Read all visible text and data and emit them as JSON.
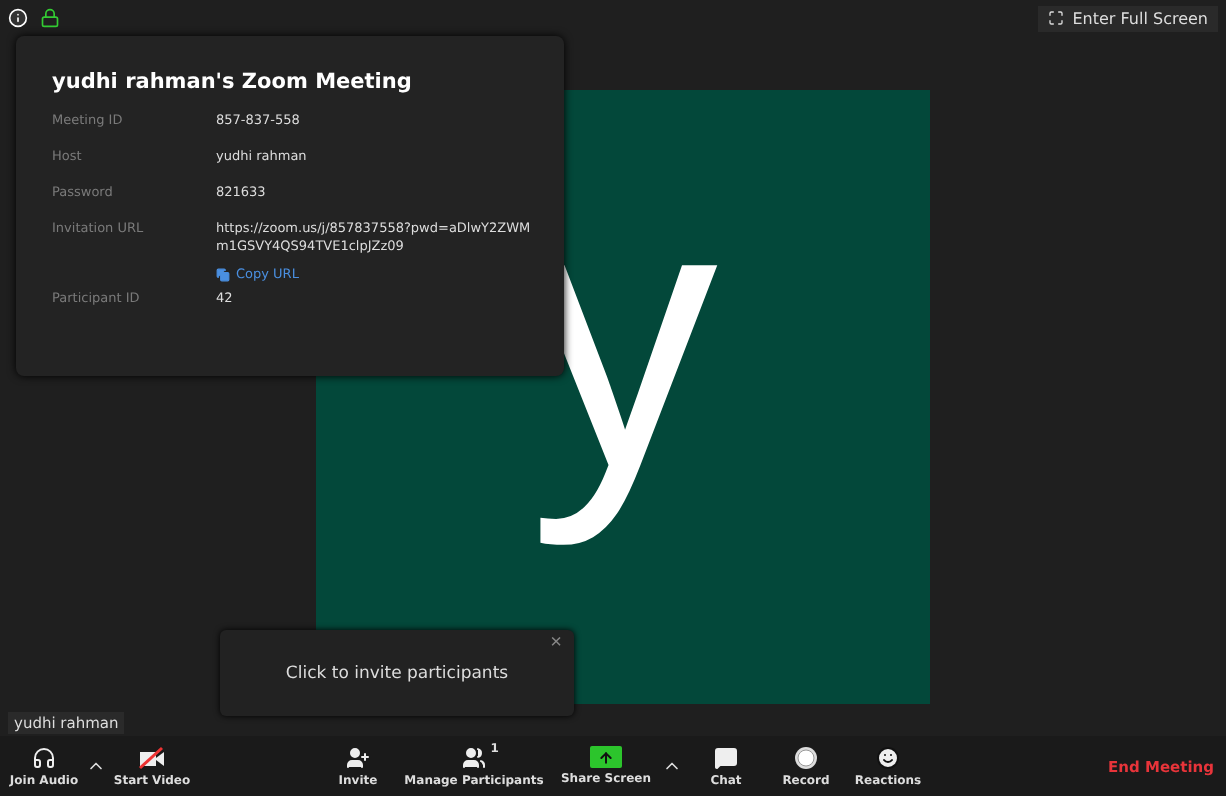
{
  "top_bar": {
    "fullscreen_button": "Enter Full Screen"
  },
  "meeting_info": {
    "title": "yudhi rahman's Zoom Meeting",
    "fields": [
      {
        "label": "Meeting ID",
        "value": "857-837-558"
      },
      {
        "label": "Host",
        "value": "yudhi rahman"
      },
      {
        "label": "Password",
        "value": "821633"
      },
      {
        "label": "Invitation URL",
        "value": "https://zoom.us/j/857837558?pwd=aDlwY2ZWMm1GSVY4QS94TVE1clpJZz09",
        "link": "Copy URL"
      },
      {
        "label": "Participant ID",
        "value": "42"
      }
    ]
  },
  "video": {
    "avatar_letter": "y",
    "name_tag": "yudhi rahman"
  },
  "tooltip": {
    "text": "Click to invite participants",
    "close": "×"
  },
  "toolbar": {
    "buttons": [
      {
        "kind": "audio",
        "label": "Join Audio"
      },
      {
        "kind": "caret"
      },
      {
        "kind": "video",
        "label": "Start Video"
      },
      {
        "kind": "spacer"
      },
      {
        "kind": "invite",
        "label": "Invite"
      },
      {
        "kind": "participants",
        "label": "Manage Participants",
        "badge": "1"
      },
      {
        "kind": "share",
        "label": "Share Screen"
      },
      {
        "kind": "caret"
      },
      {
        "kind": "chat",
        "label": "Chat"
      },
      {
        "kind": "record",
        "label": "Record"
      },
      {
        "kind": "reactions",
        "label": "Reactions"
      }
    ],
    "end_button": "End Meeting"
  }
}
